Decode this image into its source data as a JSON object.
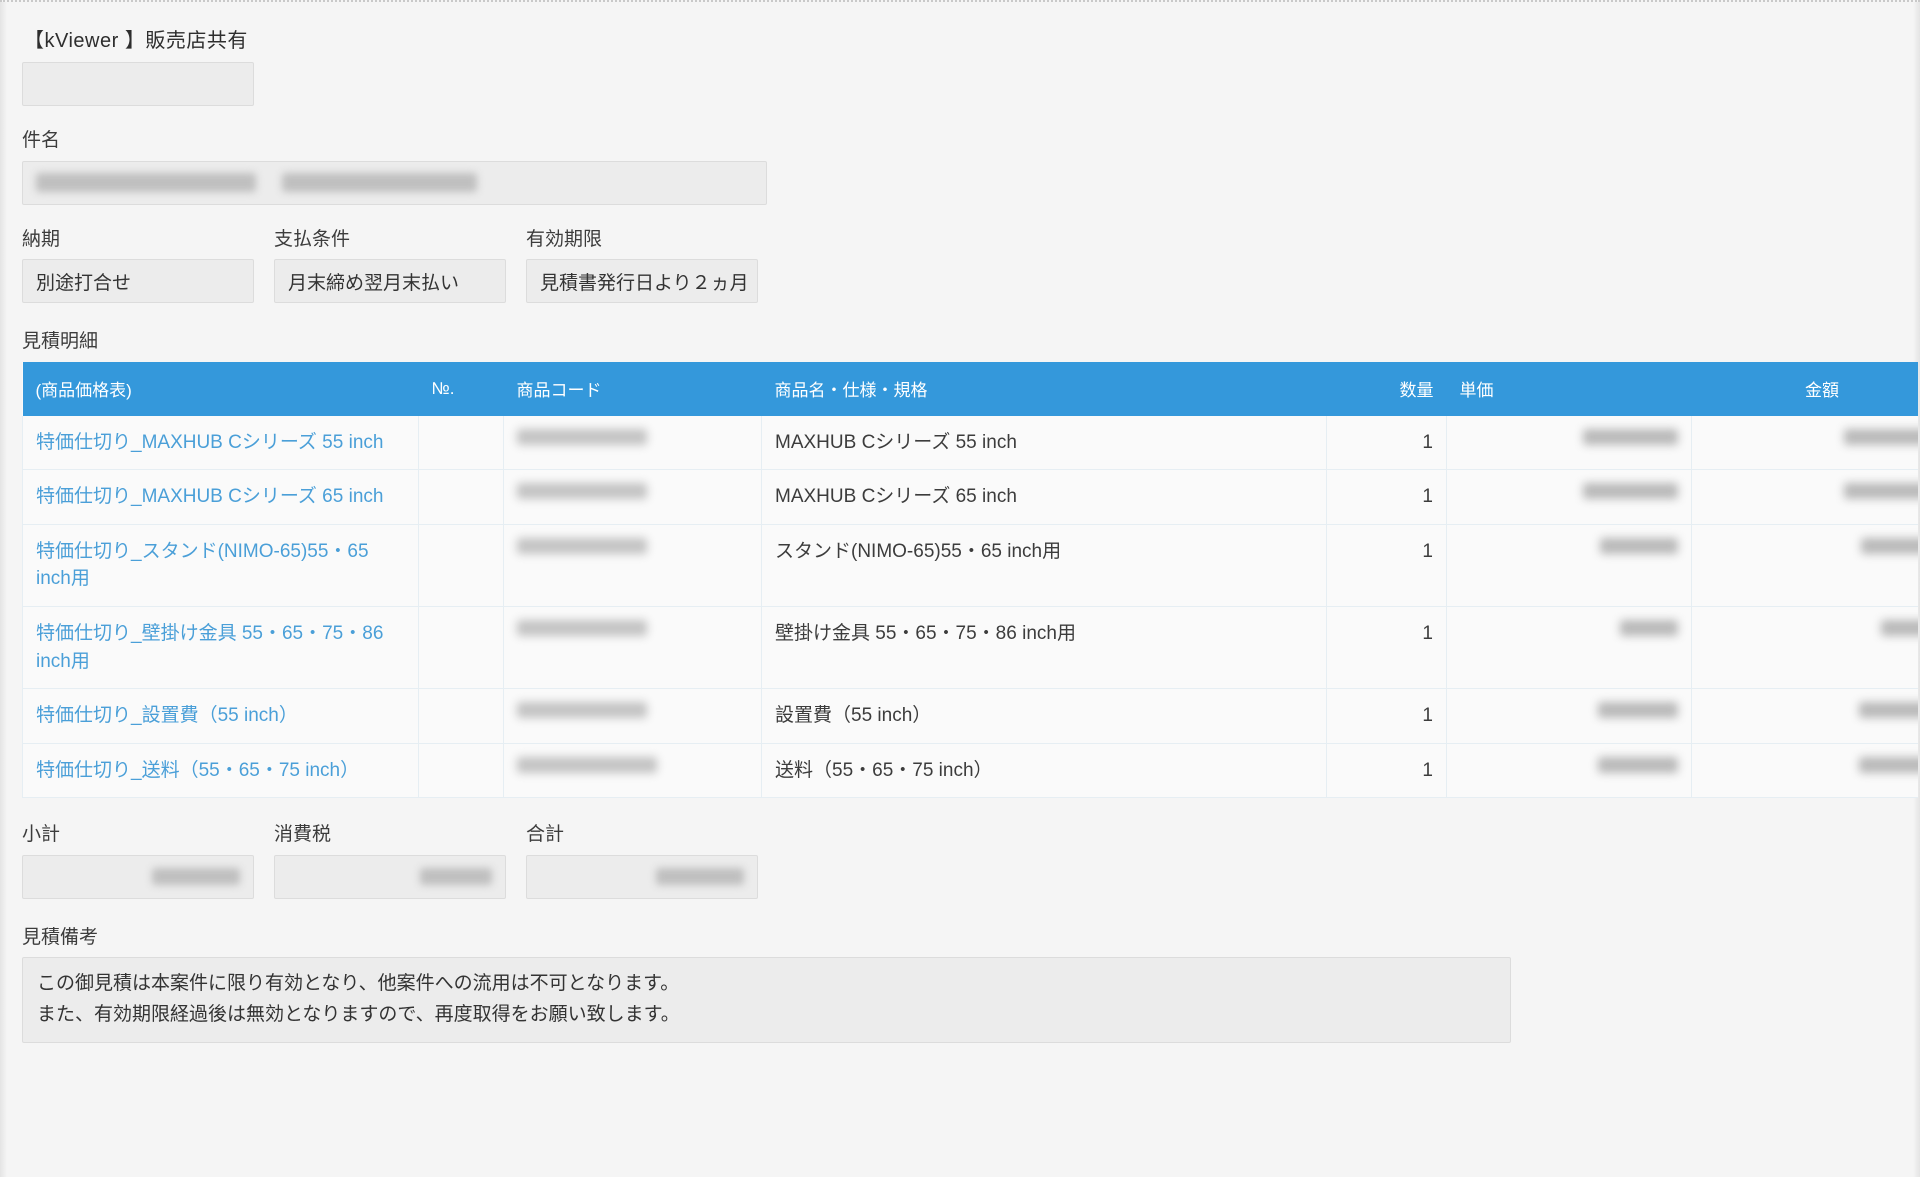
{
  "app": {
    "title": "【kViewer 】販売店共有",
    "title_field_value": ""
  },
  "form": {
    "subject": {
      "label": "件名",
      "value": ""
    },
    "delivery": {
      "label": "納期",
      "value": "別途打合せ"
    },
    "payment_terms": {
      "label": "支払条件",
      "value": "月末締め翌月末払い"
    },
    "validity": {
      "label": "有効期限",
      "value": "見積書発行日より２ヵ月"
    }
  },
  "detail": {
    "label": "見積明細",
    "columns": [
      "(商品価格表)",
      "№.",
      "商品コード",
      "商品名・仕様・規格",
      "数量",
      "単価",
      "金額"
    ],
    "rows": [
      {
        "price_list": "特価仕切り_MAXHUB Cシリーズ 55 inch",
        "no": "",
        "code": "",
        "name": "MAXHUB Cシリーズ 55 inch",
        "qty": "1",
        "unit_price": "",
        "amount": ""
      },
      {
        "price_list": "特価仕切り_MAXHUB Cシリーズ 65 inch",
        "no": "",
        "code": "",
        "name": "MAXHUB Cシリーズ 65 inch",
        "qty": "1",
        "unit_price": "",
        "amount": ""
      },
      {
        "price_list": "特価仕切り_スタンド(NIMO-65)55・65 inch用",
        "no": "",
        "code": "",
        "name": "スタンド(NIMO-65)55・65 inch用",
        "qty": "1",
        "unit_price": "",
        "amount": ""
      },
      {
        "price_list": "特価仕切り_壁掛け金具 55・65・75・86 inch用",
        "no": "",
        "code": "",
        "name": "壁掛け金具 55・65・75・86 inch用",
        "qty": "1",
        "unit_price": "",
        "amount": ""
      },
      {
        "price_list": "特価仕切り_設置費（55 inch）",
        "no": "",
        "code": "",
        "name": "設置費（55 inch）",
        "qty": "1",
        "unit_price": "",
        "amount": ""
      },
      {
        "price_list": "特価仕切り_送料（55・65・75 inch）",
        "no": "",
        "code": "",
        "name": "送料（55・65・75 inch）",
        "qty": "1",
        "unit_price": "",
        "amount": ""
      }
    ]
  },
  "totals": {
    "subtotal": {
      "label": "小計",
      "value": ""
    },
    "tax": {
      "label": "消費税",
      "value": ""
    },
    "total": {
      "label": "合計",
      "value": ""
    }
  },
  "remarks": {
    "label": "見積備考",
    "line1": "この御見積は本案件に限り有効となり、他案件への流用は不可となります。",
    "line2": "また、有効期限経過後は無効となりますので、再度取得をお願い致します。"
  },
  "colors": {
    "table_header": "#3498db",
    "link": "#4a9fd8",
    "page_bg": "#f5f5f5",
    "field_bg": "#ececec"
  }
}
